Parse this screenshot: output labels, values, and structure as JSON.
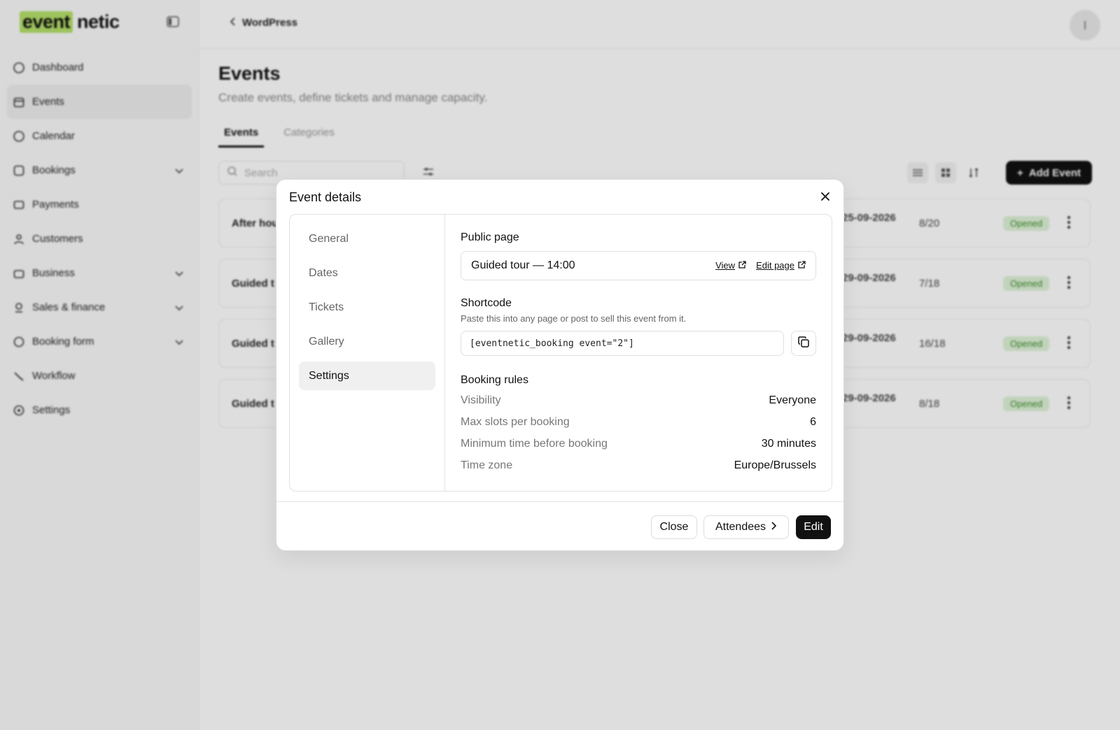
{
  "colors": {
    "accent": "#b5e06a",
    "primary": "#111111",
    "badge_bg": "#dff3d8",
    "badge_text": "#3f8f2f"
  },
  "sidebar": {
    "logo_highlight": "event",
    "logo_rest": "netic",
    "items": [
      {
        "label": "Dashboard",
        "icon": "dashboard-icon"
      },
      {
        "label": "Events",
        "icon": "events-icon"
      },
      {
        "label": "Calendar",
        "icon": "calendar-icon"
      },
      {
        "label": "Bookings",
        "icon": "bookings-icon"
      },
      {
        "label": "Payments",
        "icon": "payments-icon"
      },
      {
        "label": "Customers",
        "icon": "customers-icon"
      },
      {
        "label": "Business",
        "icon": "business-icon"
      },
      {
        "label": "Sales & finance",
        "icon": "sales-icon"
      },
      {
        "label": "Booking form",
        "icon": "form-icon"
      },
      {
        "label": "Workflow",
        "icon": "workflow-icon"
      },
      {
        "label": "Settings",
        "icon": "settings-icon"
      }
    ]
  },
  "header": {
    "breadcrumb": "WordPress"
  },
  "page": {
    "title": "Events",
    "subtitle": "Create events, define tickets and manage capacity.",
    "tabs": [
      "Events",
      "Categories"
    ],
    "search_placeholder": "Search",
    "add_button": "Add Event"
  },
  "events": [
    {
      "name": "After hou",
      "date": "25-09-2026",
      "capacity": "8/20",
      "status": "Opened"
    },
    {
      "name": "Guided t",
      "date": "29-09-2026",
      "capacity": "7/18",
      "status": "Opened"
    },
    {
      "name": "Guided t",
      "date": "29-09-2026",
      "capacity": "16/18",
      "status": "Opened"
    },
    {
      "name": "Guided t",
      "date": "29-09-2026",
      "capacity": "8/18",
      "status": "Opened"
    }
  ],
  "modal": {
    "title": "Event details",
    "nav": [
      "General",
      "Dates",
      "Tickets",
      "Gallery",
      "Settings"
    ],
    "active_nav": "Settings",
    "public_page": {
      "title": "Public page",
      "page_name": "Guided tour — 14:00",
      "view_label": "View",
      "edit_label": "Edit page"
    },
    "shortcode": {
      "title": "Shortcode",
      "help": "Paste this into any page or post to sell this event from it.",
      "value": "[eventnetic_booking event=\"2\"]"
    },
    "booking_rules": {
      "title": "Booking rules",
      "rows": [
        {
          "label": "Visibility",
          "value": "Everyone"
        },
        {
          "label": "Max slots per booking",
          "value": "6"
        },
        {
          "label": "Minimum time before booking",
          "value": "30 minutes"
        },
        {
          "label": "Time zone",
          "value": "Europe/Brussels"
        }
      ]
    },
    "footer": {
      "close": "Close",
      "attendees": "Attendees",
      "edit": "Edit"
    }
  }
}
